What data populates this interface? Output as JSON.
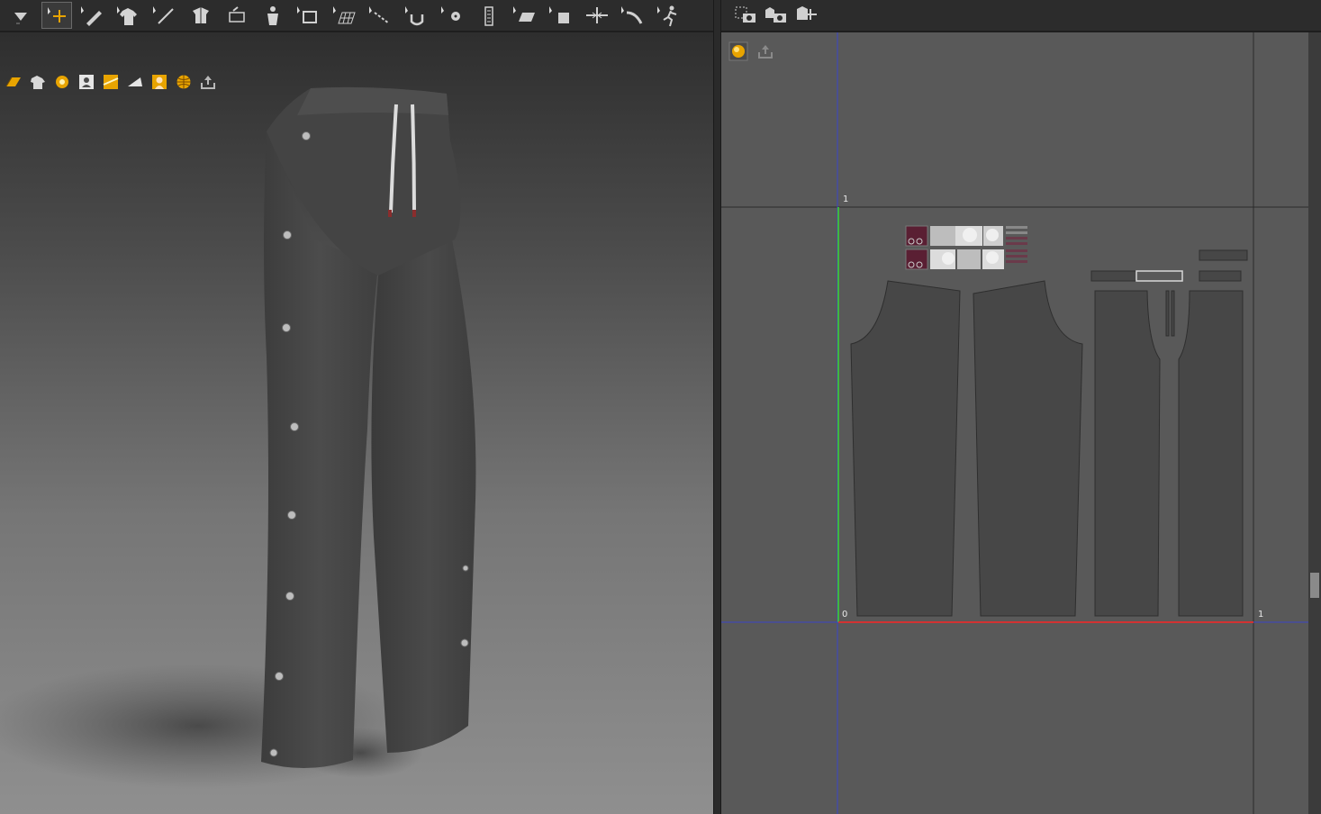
{
  "toolbar_3d": {
    "tools": [
      "fold-down-icon",
      "transform-move-icon",
      "edit-pen-icon",
      "garment-select-icon",
      "measure-line-icon",
      "tuck-icon",
      "pin-icon",
      "avatar-arrange-icon",
      "fold-icon",
      "grid-texture-icon",
      "seam-tack-icon",
      "hanger-icon",
      "button-icon",
      "zipper-icon",
      "flip-plane-icon",
      "box-select-icon",
      "strengthen-icon",
      "stretch-icon",
      "run-simulation-icon"
    ],
    "active_index": 1
  },
  "view_controls_3d": [
    "render-mode-icon",
    "garment-display-icon",
    "texture-display-icon",
    "avatar-display-icon",
    "fabric-display-icon",
    "thickness-icon",
    "skin-icon",
    "globe-icon",
    "export-icon"
  ],
  "toolbar_uv": [
    "snapshot-icon",
    "capture-pattern-icon",
    "camera-settings-icon"
  ],
  "view_controls_uv": [
    "uv-display-icon",
    "uv-export-icon"
  ],
  "uv_grid": {
    "origin_label": "0",
    "u_label": "1",
    "v_label": "1"
  },
  "colors": {
    "toolbar_bg": "#2c2c2c",
    "uv_bg": "#595959",
    "fabric": "#474747",
    "axis_u": "#d23232",
    "axis_v": "#3fb83f",
    "grid_line": "#3a45c8",
    "accent_orange": "#e8a400"
  }
}
